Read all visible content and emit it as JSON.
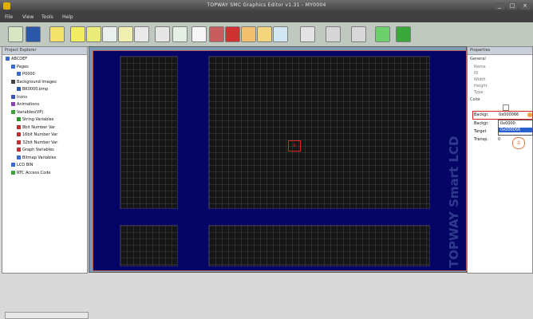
{
  "window": {
    "title": "TOPWAY SMC Graphics Editor v1.31 - MY0004",
    "minimize": "_",
    "maximize": "□",
    "close": "×"
  },
  "menubar": {
    "items": [
      "File",
      "View",
      "Tools",
      "Help"
    ]
  },
  "toolbar": {
    "buttons": [
      {
        "name": "new-file-icon",
        "color": "#d8e6c4"
      },
      {
        "name": "save-icon",
        "color": "#2a57a8"
      },
      {
        "name": "pointer-icon",
        "color": "#f3e36a"
      },
      {
        "name": "rectangle-icon",
        "color": "#f0ee60"
      },
      {
        "name": "text-field-icon",
        "color": "#e9ec79"
      },
      {
        "name": "number-field-icon",
        "color": "#eaf0ee"
      },
      {
        "name": "image-icon",
        "color": "#f0f0b0"
      },
      {
        "name": "line-icon",
        "color": "#e9e9e9"
      },
      {
        "name": "button-icon",
        "color": "#e6e6e6"
      },
      {
        "name": "clock-icon",
        "color": "#e5f0e5"
      },
      {
        "name": "keyboard-icon",
        "color": "#f7f7f7"
      },
      {
        "name": "trash-icon",
        "color": "#c85d5d"
      },
      {
        "name": "record-icon",
        "color": "#d03030"
      },
      {
        "name": "gear-icon",
        "color": "#f3c070"
      },
      {
        "name": "table-icon",
        "color": "#f2d57d"
      },
      {
        "name": "window-icon",
        "color": "#d2e7f2"
      },
      {
        "name": "bar-graph-icon",
        "color": "#e4e4e4"
      },
      {
        "name": "waveform-icon",
        "color": "#d6d6d6"
      },
      {
        "name": "histogram-icon",
        "color": "#d8d8d8"
      },
      {
        "name": "download-icon",
        "color": "#6bd06b"
      },
      {
        "name": "upload-icon",
        "color": "#3aa83a"
      }
    ]
  },
  "project_panel": {
    "title": "Project Explorer",
    "tree": [
      {
        "label": "ABCDEF",
        "level": 0,
        "color": "#3a6ad0"
      },
      {
        "label": "Pages",
        "level": 1,
        "color": "#3a6ad0"
      },
      {
        "label": "P0000",
        "level": 2,
        "color": "#3a6ad0"
      },
      {
        "label": "Background Images",
        "level": 1,
        "color": "#444444"
      },
      {
        "label": "BK0000.bmp",
        "level": 2,
        "color": "#2f59b0"
      },
      {
        "label": "Icons",
        "level": 1,
        "color": "#3b56b7"
      },
      {
        "label": "Animations",
        "level": 1,
        "color": "#8a3fb0"
      },
      {
        "label": "Variables(VP)",
        "level": 1,
        "color": "#3fa13f"
      },
      {
        "label": "String Variables",
        "level": 2,
        "color": "#2d9a2d"
      },
      {
        "label": "8bit Number Var",
        "level": 2,
        "color": "#c03030"
      },
      {
        "label": "16bit Number Var",
        "level": 2,
        "color": "#c03030"
      },
      {
        "label": "32bit Number Var",
        "level": 2,
        "color": "#c03030"
      },
      {
        "label": "Graph Variables",
        "level": 2,
        "color": "#c03030"
      },
      {
        "label": "Bitmap Variables",
        "level": 2,
        "color": "#3a6ad0"
      },
      {
        "label": "LCD BIN",
        "level": 1,
        "color": "#3a6ad0"
      },
      {
        "label": "RTC Access Code",
        "level": 1,
        "color": "#3fa13f"
      }
    ]
  },
  "canvas": {
    "background": "#050566",
    "vertical_text": "TOPWAY Smart LCD",
    "marker_label": "①"
  },
  "properties_panel": {
    "title": "Properties",
    "sections": [
      "General",
      "Color"
    ],
    "general_rows": [
      "Name",
      "ID",
      "Width",
      "Height",
      "Type"
    ],
    "color_rows": [
      "Backgr.",
      "Backgr.",
      "Target",
      "Transp."
    ],
    "backgr_value": "0x000066",
    "dropdown_options": [
      "0x0000",
      "0x000066"
    ],
    "transp_value": "0",
    "marker2_label": "②"
  }
}
